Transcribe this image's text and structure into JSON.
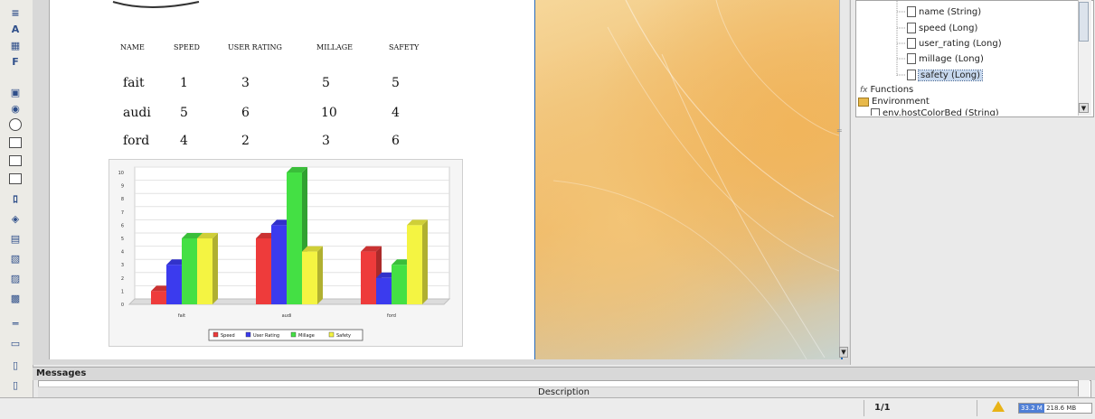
{
  "report": {
    "headers": [
      "NAME",
      "SPEED",
      "USER RATING",
      "MILLAGE",
      "SAFETY"
    ],
    "rows": [
      {
        "name": "fait",
        "speed": "1",
        "user_rating": "3",
        "millage": "5",
        "safety": "5"
      },
      {
        "name": "audi",
        "speed": "5",
        "user_rating": "6",
        "millage": "10",
        "safety": "4"
      },
      {
        "name": "ford",
        "speed": "4",
        "user_rating": "2",
        "millage": "3",
        "safety": "6"
      }
    ]
  },
  "chart_data": {
    "type": "bar",
    "categories": [
      "fait",
      "audi",
      "ford"
    ],
    "series": [
      {
        "name": "Speed",
        "values": [
          1,
          5,
          4
        ],
        "color": "#ee3b3b"
      },
      {
        "name": "User Rating",
        "values": [
          3,
          6,
          2
        ],
        "color": "#3b3bee"
      },
      {
        "name": "Millage",
        "values": [
          5,
          10,
          3
        ],
        "color": "#44e044"
      },
      {
        "name": "Safety",
        "values": [
          5,
          4,
          6
        ],
        "color": "#f4f442"
      }
    ],
    "ylim": [
      0,
      10
    ],
    "yticks": [
      0,
      1,
      2,
      3,
      4,
      5,
      6,
      7,
      8,
      9,
      10
    ],
    "grid": true,
    "legend_position": "bottom"
  },
  "tree": {
    "fields": [
      {
        "label": "name (String)"
      },
      {
        "label": "speed (Long)"
      },
      {
        "label": "user_rating (Long)"
      },
      {
        "label": "millage (Long)"
      },
      {
        "label": "safety (Long)"
      }
    ],
    "functions_label": "Functions",
    "environment_label": "Environment",
    "env_child_label": "env.hostColorBed (String)"
  },
  "messages": {
    "title": "Messages",
    "column_description": "Description"
  },
  "status": {
    "page": "1/1",
    "memory_used": "33.2 M",
    "memory_total": "218.6 MB"
  }
}
